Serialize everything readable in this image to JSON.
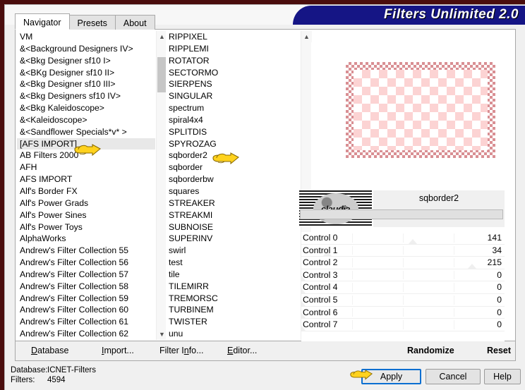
{
  "window": {
    "title": "Filters Unlimited 2.0",
    "frame_color": "#4a0d0d",
    "banner_color": "#151585"
  },
  "tabs": [
    {
      "label": "Navigator",
      "active": true
    },
    {
      "label": "Presets",
      "active": false
    },
    {
      "label": "About",
      "active": false
    }
  ],
  "categories": {
    "selected": "[AFS IMPORT]",
    "items": [
      "VM",
      "&<Background Designers IV>",
      "&<Bkg Designer sf10 I>",
      "&<BKg Designer sf10 II>",
      "&<Bkg Designer sf10 III>",
      "&<Bkg Designers sf10 IV>",
      "&<Bkg Kaleidoscope>",
      "&<Kaleidoscope>",
      "&<Sandflower Specials*v* >",
      "[AFS IMPORT]",
      "AB Filters 2000",
      "AFH",
      "AFS IMPORT",
      "Alf's Border FX",
      "Alf's Power Grads",
      "Alf's Power Sines",
      "Alf's Power Toys",
      "AlphaWorks",
      "Andrew's Filter Collection 55",
      "Andrew's Filter Collection 56",
      "Andrew's Filter Collection 57",
      "Andrew's Filter Collection 58",
      "Andrew's Filter Collection 59",
      "Andrew's Filter Collection 60",
      "Andrew's Filter Collection 61",
      "Andrew's Filter Collection 62"
    ]
  },
  "filters": {
    "selected": "sqborder2",
    "items": [
      "RIPPIXEL",
      "RIPPLEMI",
      "ROTATOR",
      "SECTORMO",
      "SIERPENS",
      "SINGULAR",
      "spectrum",
      "spiral4x4",
      "SPLITDIS",
      "SPYROZAG",
      "sqborder2",
      "sqborder",
      "sqborderbw",
      "squares",
      "STREAKER",
      "STREAKMI",
      "SUBNOISE",
      "SUPERINV",
      "swirl",
      "test",
      "tile",
      "TILEMIRR",
      "TREMORSC",
      "TURBINEM",
      "TWISTER",
      "unu"
    ]
  },
  "preview": {
    "border_color": "#d98f93",
    "fill_color": "#fcd3d3"
  },
  "watermark": {
    "text": "claudia"
  },
  "controls": {
    "title": "sqborder2",
    "rows": [
      {
        "label": "Control 0",
        "value": "141",
        "pct": 55
      },
      {
        "label": "Control 1",
        "value": "34",
        "pct": 13
      },
      {
        "label": "Control 2",
        "value": "215",
        "pct": 84
      },
      {
        "label": "Control 3",
        "value": "0",
        "pct": 0
      },
      {
        "label": "Control 4",
        "value": "0",
        "pct": 0
      },
      {
        "label": "Control 5",
        "value": "0",
        "pct": 0
      },
      {
        "label": "Control 6",
        "value": "0",
        "pct": 0
      },
      {
        "label": "Control 7",
        "value": "0",
        "pct": 0
      }
    ]
  },
  "menu": {
    "database": "Database",
    "import": "Import...",
    "filter_info": "Filter Info...",
    "editor": "Editor...",
    "randomize": "Randomize",
    "reset": "Reset"
  },
  "status": {
    "database_label": "Database:",
    "database_value": "ICNET-Filters",
    "filters_label": "Filters:",
    "filters_value": "4594"
  },
  "buttons": {
    "apply": "Apply",
    "cancel": "Cancel",
    "help": "Help"
  }
}
